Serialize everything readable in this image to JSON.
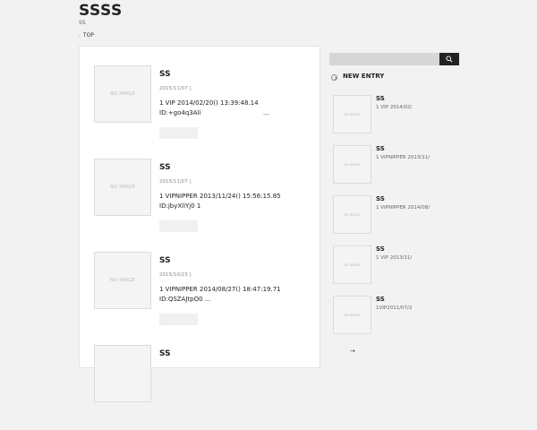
{
  "site": {
    "title": "SSSS",
    "description": "SS"
  },
  "breadcrumb": {
    "caret": "›",
    "label": "TOP"
  },
  "entries": [
    {
      "title": "SS",
      "date": "2015/11/07 |.",
      "excerpt_line1": "1 VIP 2014/02/20() 13:39:48.14",
      "excerpt_line2": "ID:+go4q3Ali",
      "ellipsis": "...",
      "thumb_text": "NO IMAGE"
    },
    {
      "title": "SS",
      "date": "2015/11/07 |.",
      "excerpt_line1": "1 VIPNIPPER 2013/11/24() 15:56:15.85",
      "excerpt_line2": "ID:jbyXliYj0 1",
      "ellipsis": "",
      "thumb_text": "NO IMAGE"
    },
    {
      "title": "SS",
      "date": "2015/10/23 |.",
      "excerpt_line1": "1 VIPNIPPER 2014/08/27() 18:47:19.71",
      "excerpt_line2": "ID:QSZAJtpO0 ...",
      "ellipsis": "",
      "thumb_text": "NO IMAGE"
    },
    {
      "title": "SS",
      "date": "",
      "excerpt_line1": "",
      "excerpt_line2": "",
      "ellipsis": "",
      "thumb_text": ""
    }
  ],
  "sidebar": {
    "search": {
      "value": "",
      "icon": "search-icon"
    },
    "new_entry": {
      "title": "NEW ENTRY",
      "icon": "circle-arrow-icon",
      "items": [
        {
          "title": "SS",
          "excerpt": "1 VIP 2014/02/",
          "thumb_text": "NO IMAGE"
        },
        {
          "title": "SS",
          "excerpt": "1 VIPNIPPER 2013/11/",
          "thumb_text": "NO IMAGE"
        },
        {
          "title": "SS",
          "excerpt": "1 VIPNIPPER 2014/08/",
          "thumb_text": "NO IMAGE"
        },
        {
          "title": "SS",
          "excerpt": "1 VIP 2013/11/",
          "thumb_text": "NO IMAGE"
        },
        {
          "title": "SS",
          "excerpt": "1VIP2011/07/2",
          "thumb_text": "NO IMAGE"
        }
      ]
    },
    "more_link": "→"
  },
  "colors": {
    "search_button": "#222222",
    "background": "#f2f2f2",
    "card": "#ffffff"
  }
}
